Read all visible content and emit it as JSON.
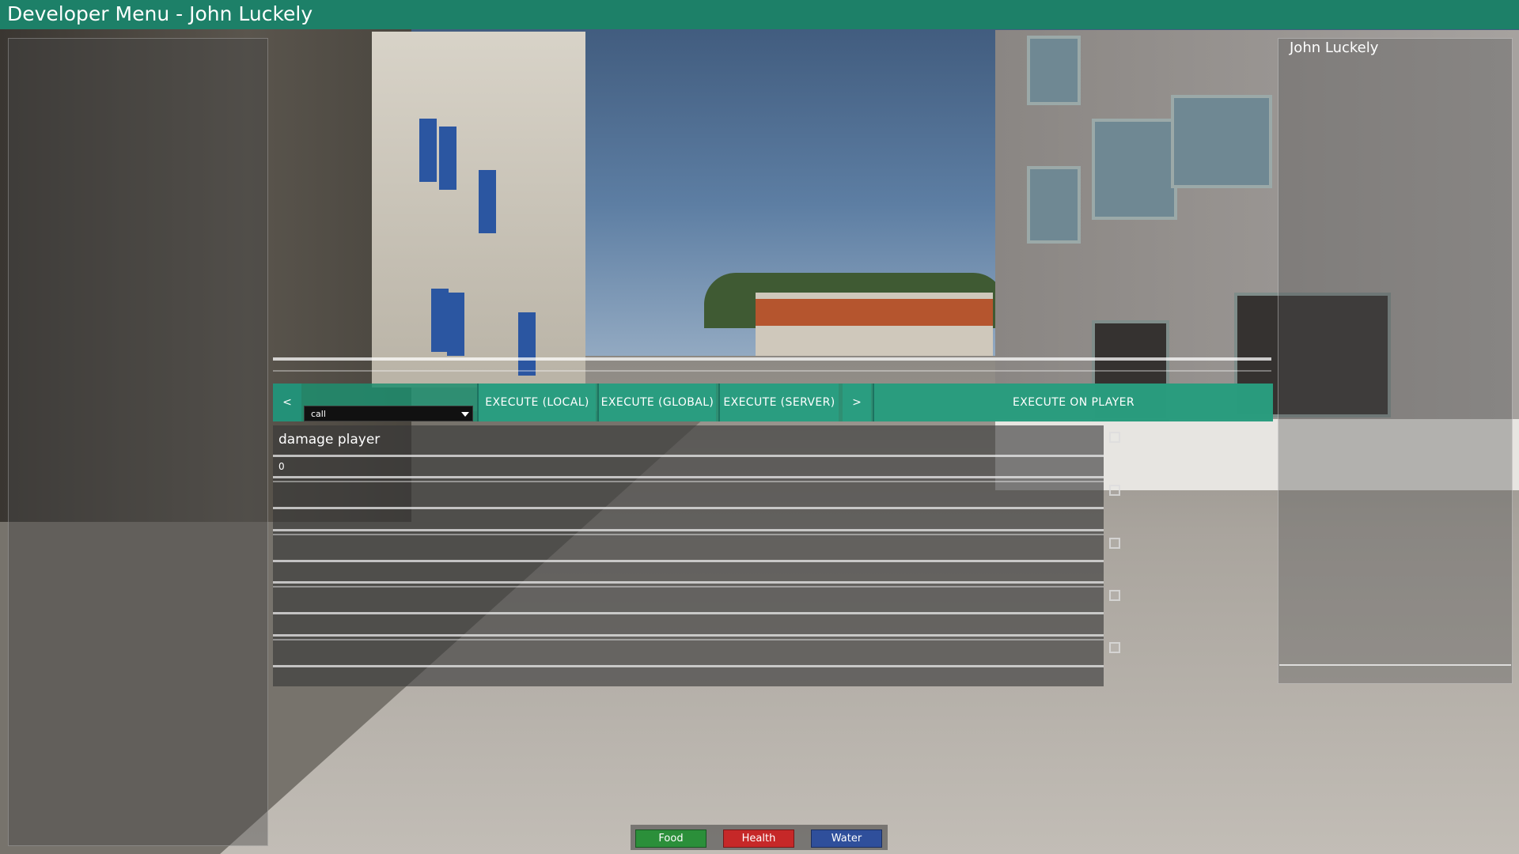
{
  "window": {
    "title": "Developer Menu - John Luckely"
  },
  "player_list": {
    "items": [
      "John Luckely"
    ]
  },
  "toolbar": {
    "prev_label": "<",
    "next_label": ">",
    "mode_combo_value": "call",
    "execute_local_label": "EXECUTE (LOCAL)",
    "execute_global_label": "EXECUTE (GLOBAL)",
    "execute_server_label": "EXECUTE (SERVER)",
    "execute_on_player_label": "EXECUTE ON PLAYER"
  },
  "command": {
    "name": "damage player",
    "params": [
      "0",
      "",
      "",
      "",
      ""
    ],
    "checkboxes_checked": [
      false,
      false,
      false,
      false,
      false
    ]
  },
  "status": {
    "food_label": "Food",
    "health_label": "Health",
    "water_label": "Water",
    "food_color": "#2b8f3a",
    "health_color": "#c62828",
    "water_color": "#2f4f9b"
  },
  "theme": {
    "accent": "#1d8068",
    "button": "#2a9d80"
  }
}
